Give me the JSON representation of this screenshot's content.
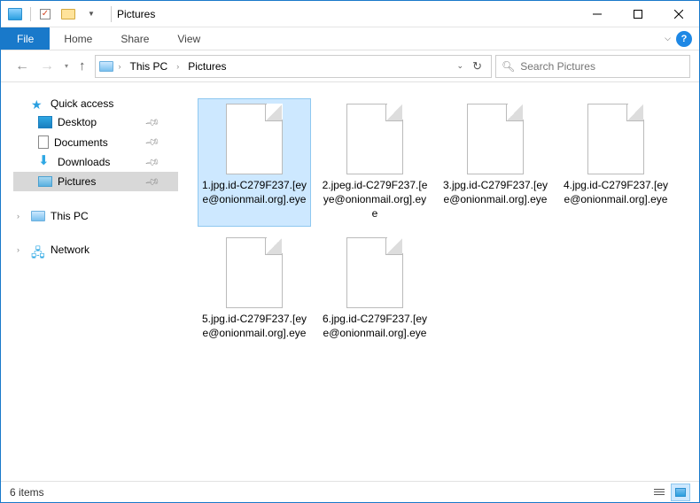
{
  "window": {
    "title": "Pictures"
  },
  "ribbon": {
    "file": "File",
    "tabs": [
      "Home",
      "Share",
      "View"
    ]
  },
  "breadcrumb": {
    "root": "This PC",
    "folder": "Pictures"
  },
  "search": {
    "placeholder": "Search Pictures"
  },
  "sidebar": {
    "quick_access": "Quick access",
    "items": [
      {
        "label": "Desktop",
        "pinned": true
      },
      {
        "label": "Documents",
        "pinned": true
      },
      {
        "label": "Downloads",
        "pinned": true
      },
      {
        "label": "Pictures",
        "pinned": true,
        "selected": true
      }
    ],
    "this_pc": "This PC",
    "network": "Network"
  },
  "files": [
    {
      "name": "1.jpg.id-C279F237.[eye@onionmail.org].eye",
      "selected": true
    },
    {
      "name": "2.jpeg.id-C279F237.[eye@onionmail.org].eye"
    },
    {
      "name": "3.jpg.id-C279F237.[eye@onionmail.org].eye"
    },
    {
      "name": "4.jpg.id-C279F237.[eye@onionmail.org].eye"
    },
    {
      "name": "5.jpg.id-C279F237.[eye@onionmail.org].eye"
    },
    {
      "name": "6.jpg.id-C279F237.[eye@onionmail.org].eye"
    }
  ],
  "status": {
    "text": "6 items"
  }
}
